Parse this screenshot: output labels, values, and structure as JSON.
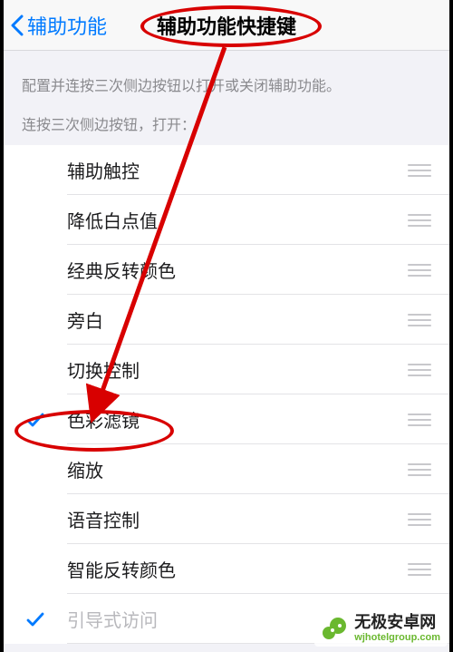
{
  "nav": {
    "back_label": "辅助功能",
    "title": "辅助功能快捷键"
  },
  "intro": {
    "desc": "配置并连按三次侧边按钮以打开或关闭辅助功能。",
    "subhead": "连按三次侧边按钮，打开："
  },
  "items": [
    {
      "label": "辅助触控",
      "checked": false,
      "dim": false
    },
    {
      "label": "降低白点值",
      "checked": false,
      "dim": false
    },
    {
      "label": "经典反转颜色",
      "checked": false,
      "dim": false
    },
    {
      "label": "旁白",
      "checked": false,
      "dim": false
    },
    {
      "label": "切换控制",
      "checked": false,
      "dim": false
    },
    {
      "label": "色彩滤镜",
      "checked": true,
      "dim": false
    },
    {
      "label": "缩放",
      "checked": false,
      "dim": false
    },
    {
      "label": "语音控制",
      "checked": false,
      "dim": false
    },
    {
      "label": "智能反转颜色",
      "checked": false,
      "dim": false
    },
    {
      "label": "引导式访问",
      "checked": true,
      "dim": true
    }
  ],
  "watermark": {
    "cn": "无极安卓网",
    "en": "wjhotelgroup.com"
  }
}
